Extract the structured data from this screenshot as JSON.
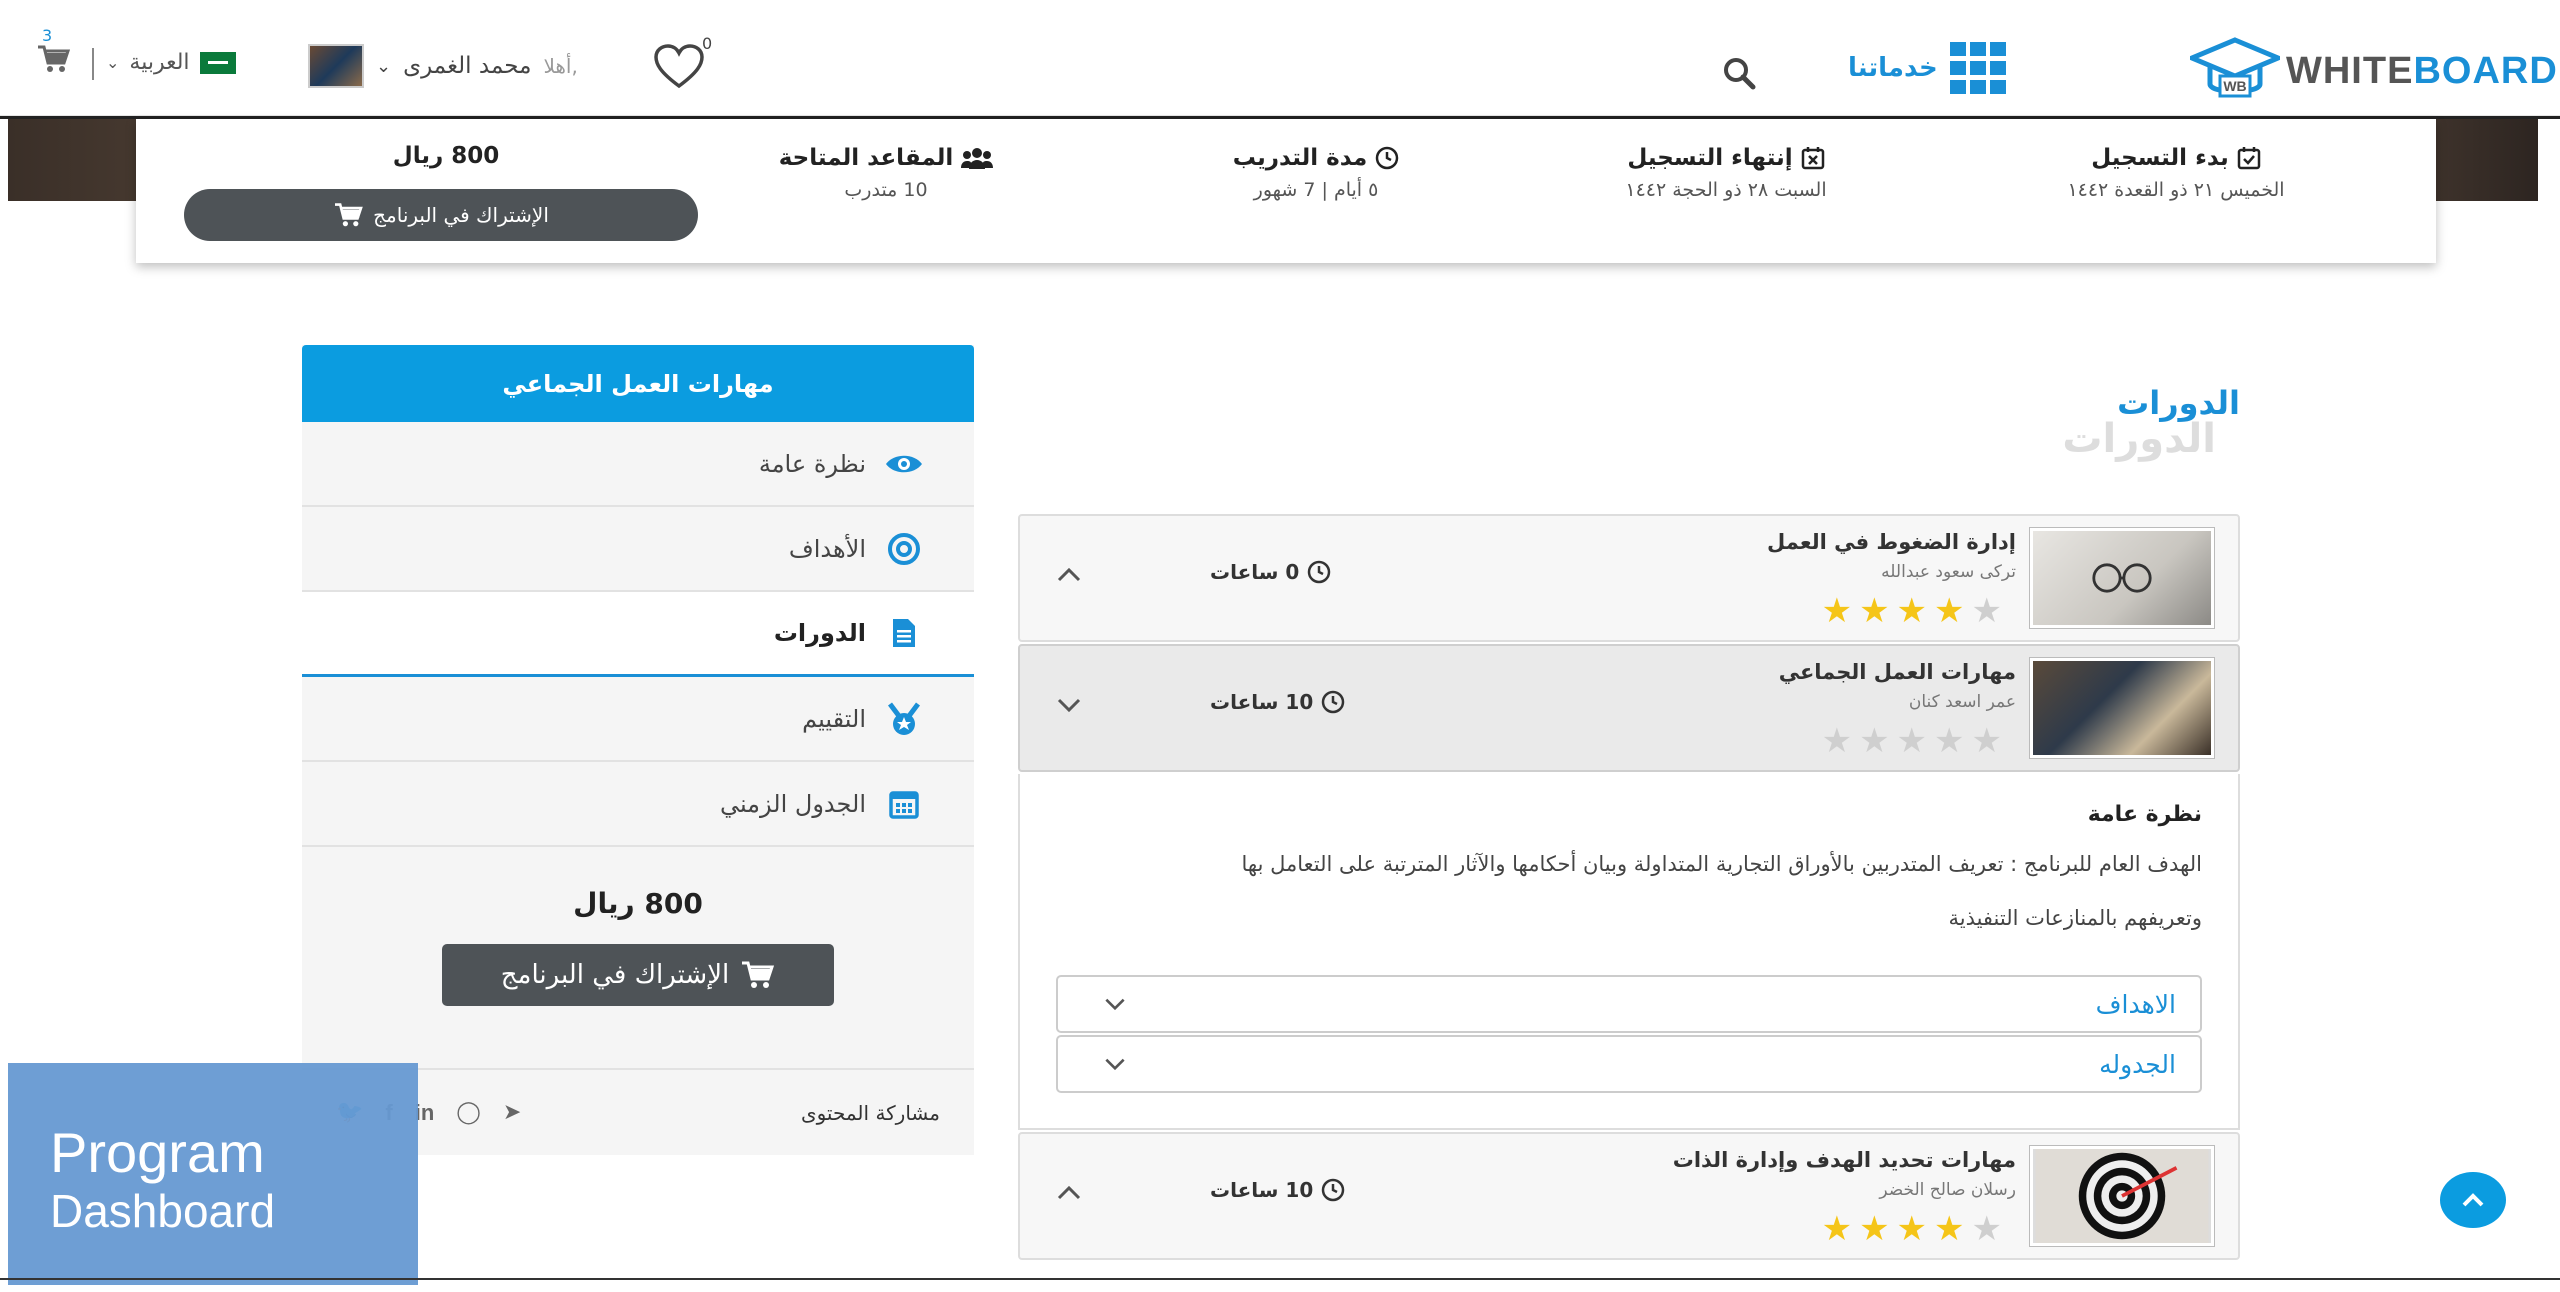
{
  "header": {
    "logo_text": "WHITE",
    "logo_text_accent": "BOARD",
    "services_label": "خدماتنا",
    "wishlist_count": "0",
    "greeting": "أهلا,",
    "user_name": "محمد الغمرى",
    "language": "العربية",
    "cart_count": "3"
  },
  "program_info": {
    "reg_start_label": "بدء التسجيل",
    "reg_start_value": "الخميس ٢١ ذو القعدة ١٤٤٢",
    "reg_end_label": "إنتهاء التسجيل",
    "reg_end_value": "السبت ٢٨ ذو الحجة ١٤٤٢",
    "duration_label": "مدة التدريب",
    "duration_value": "٥ أيام  |  7 شهور",
    "seats_label": "المقاعد المتاحة",
    "seats_value": "10 متدرب",
    "price": "800 ريال",
    "subscribe_label": "الإشتراك في البرنامج"
  },
  "section": {
    "title": "الدورات",
    "title_shadow": "الدورات"
  },
  "sidebar": {
    "header": "مهارات العمل الجماعي",
    "items": [
      {
        "label": "نظرة عامة",
        "icon": "eye-icon"
      },
      {
        "label": "الأهداف",
        "icon": "target-icon"
      },
      {
        "label": "الدورات",
        "icon": "document-icon"
      },
      {
        "label": "التقييم",
        "icon": "medal-icon"
      },
      {
        "label": "الجدول الزمني",
        "icon": "calendar-icon"
      }
    ],
    "price": "800 ريال",
    "subscribe_label": "الإشتراك في البرنامج",
    "share_label": "مشاركة المحتوى"
  },
  "courses": [
    {
      "title": "إدارة الضغوط في العمل",
      "instructor": "تركى سعود عبدالله",
      "duration": "0 ساعات",
      "rating": 4
    },
    {
      "title": "مهارات العمل الجماعي",
      "instructor": "عمر اسعد كنان",
      "duration": "10 ساعات",
      "rating": 0
    },
    {
      "title": "مهارات تحديد الهدف وإدارة الذات",
      "instructor": "رسلان صالح الخضر",
      "duration": "10 ساعات",
      "rating": 4
    }
  ],
  "course_detail": {
    "overview_title": "نظرة عامة",
    "description_line1": "الهدف العام للبرنامج : تعريف المتدربين بالأوراق التجارية المتداولة وبيان أحكامها والآثار المترتبة على التعامل بها",
    "description_line2": "وتعريفهم بالمنازعات التنفيذية",
    "accordion_goals": "الاهداف",
    "accordion_schedule": "الجدوله"
  },
  "overlay": {
    "line1": "Program",
    "line2": "Dashboard"
  },
  "colors": {
    "accent": "#1a8fd6",
    "header_blue": "#0b9ce0",
    "star_on": "#f5c518",
    "star_off": "#cfcfcf",
    "button_dark": "#4e5357"
  }
}
